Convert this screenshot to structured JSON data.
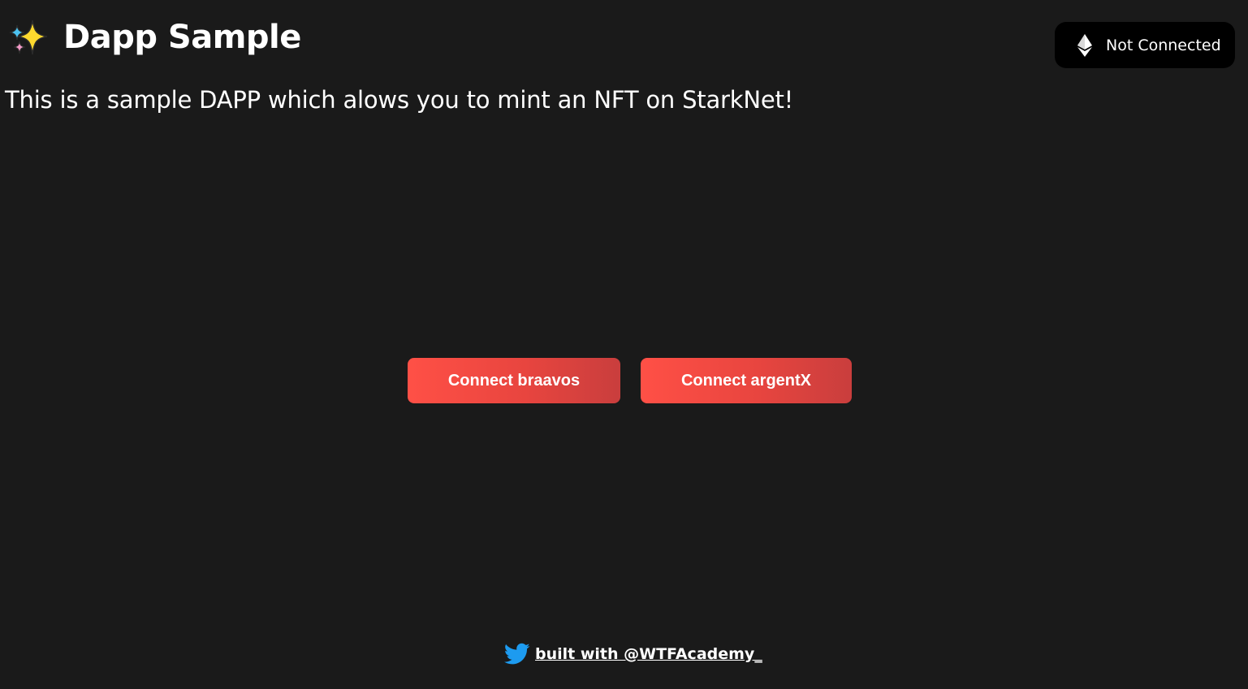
{
  "header": {
    "icon": "sparkles-icon",
    "title": "Dapp Sample"
  },
  "subtitle": "This is a sample DAPP which alows you to mint an NFT on StarkNet!",
  "wallet_status": {
    "icon": "ethereum-icon",
    "label": "Not Connected"
  },
  "buttons": {
    "braavos_label": "Connect braavos",
    "argentx_label": "Connect argentX"
  },
  "footer": {
    "icon": "twitter-icon",
    "link_text": "built with @WTFAcademy_"
  },
  "colors": {
    "background": "#1a1a1a",
    "button_gradient_start": "#ff5046",
    "button_gradient_end": "#c93e3d",
    "twitter_blue": "#1d9bf0",
    "wallet_badge_bg": "#000000"
  }
}
